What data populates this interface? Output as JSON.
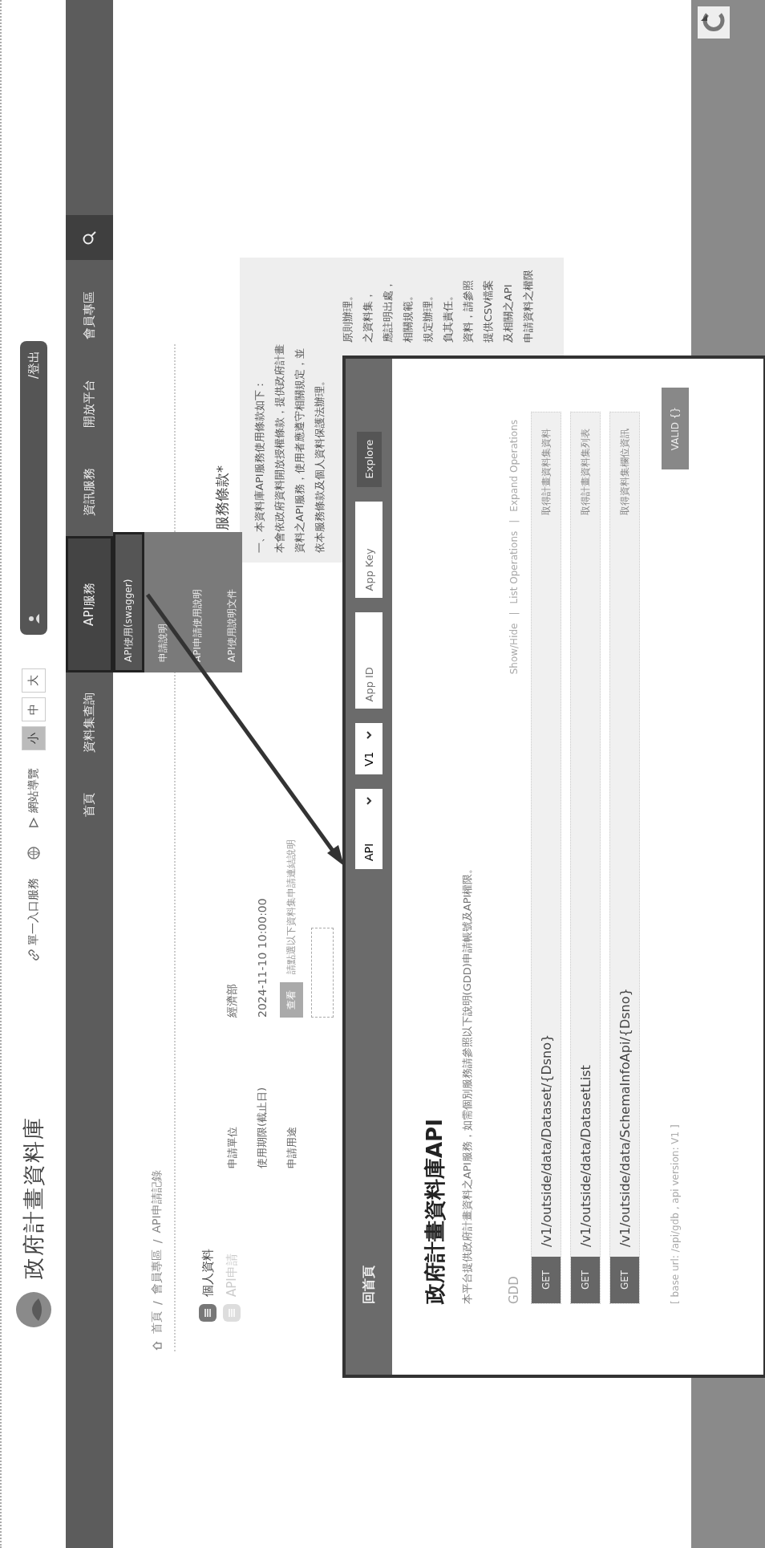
{
  "header": {
    "title": "政府計畫資料庫",
    "links": [
      {
        "kind": "portal",
        "label": "單一入口服務"
      },
      {
        "kind": "sitemap",
        "label": "網站導覽"
      }
    ],
    "font_sizes": [
      {
        "label": "小",
        "selected": true
      },
      {
        "label": "中",
        "selected": false
      },
      {
        "label": "大",
        "selected": false
      }
    ],
    "user": {
      "logout": "/登出"
    }
  },
  "nav": {
    "items": [
      {
        "label": "首頁",
        "selected": false
      },
      {
        "label": "資料集查詢",
        "selected": false
      },
      {
        "label": "API服務",
        "selected": true,
        "menu": [
          {
            "label": "API使用(swagger)",
            "selected": true
          },
          {
            "label": "申請說明",
            "selected": false
          },
          {
            "label": "API申請使用說明",
            "selected": false
          },
          {
            "label": "API使用說明文件",
            "selected": false
          }
        ]
      },
      {
        "label": "資訊服務",
        "selected": false
      },
      {
        "label": "開放平台",
        "selected": false
      },
      {
        "label": "會員專區",
        "selected": false
      }
    ]
  },
  "breadcrumb": [
    "首頁",
    "會員專區",
    "API申請記錄"
  ],
  "breadcrumb_separator": "/",
  "sidebar": {
    "items": [
      {
        "label": "個人資料",
        "selected": true
      },
      {
        "label": "API申請",
        "selected": false
      }
    ]
  },
  "info": {
    "rows": [
      {
        "kind": "text",
        "label": "申請單位",
        "value": "經濟部"
      },
      {
        "kind": "text",
        "label": "使用期限(截止日)",
        "value": "2024-11-10 10:00:00"
      },
      {
        "kind": "action",
        "label": "申請用途",
        "button": "查看",
        "value": "請點選以下資料集申請連結說明"
      }
    ]
  },
  "terms": {
    "title": "服務條款*",
    "lines": [
      "一、本資料庫API服務使用條款如下：",
      "本會依政府資料開放授權條款，提供政府計畫",
      "資料之API服務，使用者應遵守相關規定，並",
      "依本服務條款及個人資料保護法辦理。"
    ],
    "tails": [
      "原則辦理。",
      "之資料集，",
      "應註明出處，",
      "相關規範。",
      "規定辦理。",
      "負其責任。",
      "資料，請參照",
      "提供CSV檔案",
      "及相關之API",
      "申請資料之權限"
    ]
  },
  "modal": {
    "home": "回首頁",
    "controls": [
      {
        "kind": "select",
        "value": "API"
      },
      {
        "kind": "select",
        "value": "V1"
      },
      {
        "kind": "input",
        "placeholder": "App ID"
      },
      {
        "kind": "input",
        "placeholder": "App Key"
      },
      {
        "kind": "button",
        "label": "Explore"
      }
    ],
    "title": "政府計畫資料庫API",
    "description": "本平台提供政府計畫資料之API服務，如需個別服務請參照以下說明(GDD)申請帳號及API權限。",
    "group": "GDD",
    "link_separator": "|",
    "links": [
      "Show/Hide",
      "List Operations",
      "Expand Operations"
    ],
    "endpoints": [
      {
        "method": "GET",
        "path": "/v1/outside/data/Dataset/{Dsno}",
        "summary": "取得計畫資料集資料"
      },
      {
        "method": "GET",
        "path": "/v1/outside/data/DatasetList",
        "summary": "取得計畫資料集列表"
      },
      {
        "method": "GET",
        "path": "/v1/outside/data/SchemaInfoApi/{Dsno}",
        "summary": "取得資料集欄位資訊"
      }
    ],
    "base_url": "[ base url: /api/gdb , api version: V1 ]",
    "validator": "VALID {}"
  }
}
